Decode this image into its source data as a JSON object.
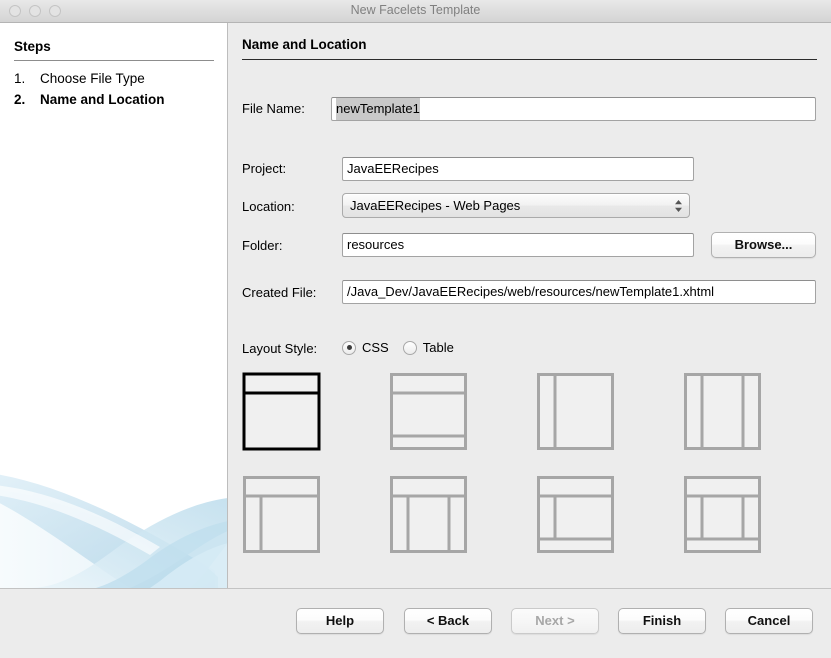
{
  "window": {
    "title": "New Facelets Template",
    "traffic_lights": [
      "close-button",
      "minimize-button",
      "zoom-button"
    ]
  },
  "steps_panel": {
    "heading": "Steps",
    "items": [
      {
        "num": "1.",
        "label": "Choose File Type",
        "current": false
      },
      {
        "num": "2.",
        "label": "Name and Location",
        "current": true
      }
    ]
  },
  "content": {
    "heading": "Name and Location",
    "fields": {
      "file_name": {
        "label": "File Name:",
        "value": "newTemplate1",
        "selected": true
      },
      "project": {
        "label": "Project:",
        "value": "JavaEERecipes"
      },
      "location": {
        "label": "Location:",
        "value": "JavaEERecipes - Web Pages"
      },
      "folder": {
        "label": "Folder:",
        "value": "resources"
      },
      "created_file": {
        "label": "Created File:",
        "value": "/Java_Dev/JavaEERecipes/web/resources/newTemplate1.xhtml"
      }
    },
    "browse_button": "Browse...",
    "layout_style": {
      "label": "Layout Style:",
      "options": [
        {
          "label": "CSS",
          "selected": true
        },
        {
          "label": "Table",
          "selected": false
        }
      ]
    },
    "layout_thumbnails": [
      {
        "name": "header-body",
        "selected": true,
        "regions": [
          "header",
          "body"
        ]
      },
      {
        "name": "header-body-footer",
        "selected": false,
        "regions": [
          "header",
          "body",
          "footer"
        ]
      },
      {
        "name": "left-content",
        "selected": false,
        "regions": [
          "left",
          "body"
        ]
      },
      {
        "name": "left-content-right",
        "selected": false,
        "regions": [
          "left",
          "body",
          "right"
        ]
      },
      {
        "name": "header-left-content",
        "selected": false,
        "regions": [
          "header",
          "left",
          "body"
        ]
      },
      {
        "name": "header-left-content-right",
        "selected": false,
        "regions": [
          "header",
          "left",
          "body",
          "right"
        ]
      },
      {
        "name": "header-left-content-footer",
        "selected": false,
        "regions": [
          "header",
          "left",
          "body",
          "footer"
        ]
      },
      {
        "name": "header-left-content-right-footer",
        "selected": false,
        "regions": [
          "header",
          "left",
          "body",
          "right",
          "footer"
        ]
      }
    ]
  },
  "footer": {
    "buttons": [
      {
        "name": "help",
        "label": "Help",
        "disabled": false
      },
      {
        "name": "back",
        "label": "< Back",
        "disabled": false
      },
      {
        "name": "next",
        "label": "Next >",
        "disabled": true
      },
      {
        "name": "finish",
        "label": "Finish",
        "disabled": false
      },
      {
        "name": "cancel",
        "label": "Cancel",
        "disabled": false
      }
    ]
  },
  "colors": {
    "panel_bg": "#ececec",
    "steps_bg": "#ffffff",
    "selection": "#c9c9c9",
    "thumb_line": "#a6a6a6",
    "thumb_selected_line": "#000000",
    "watermark": "#c9e2ef"
  }
}
